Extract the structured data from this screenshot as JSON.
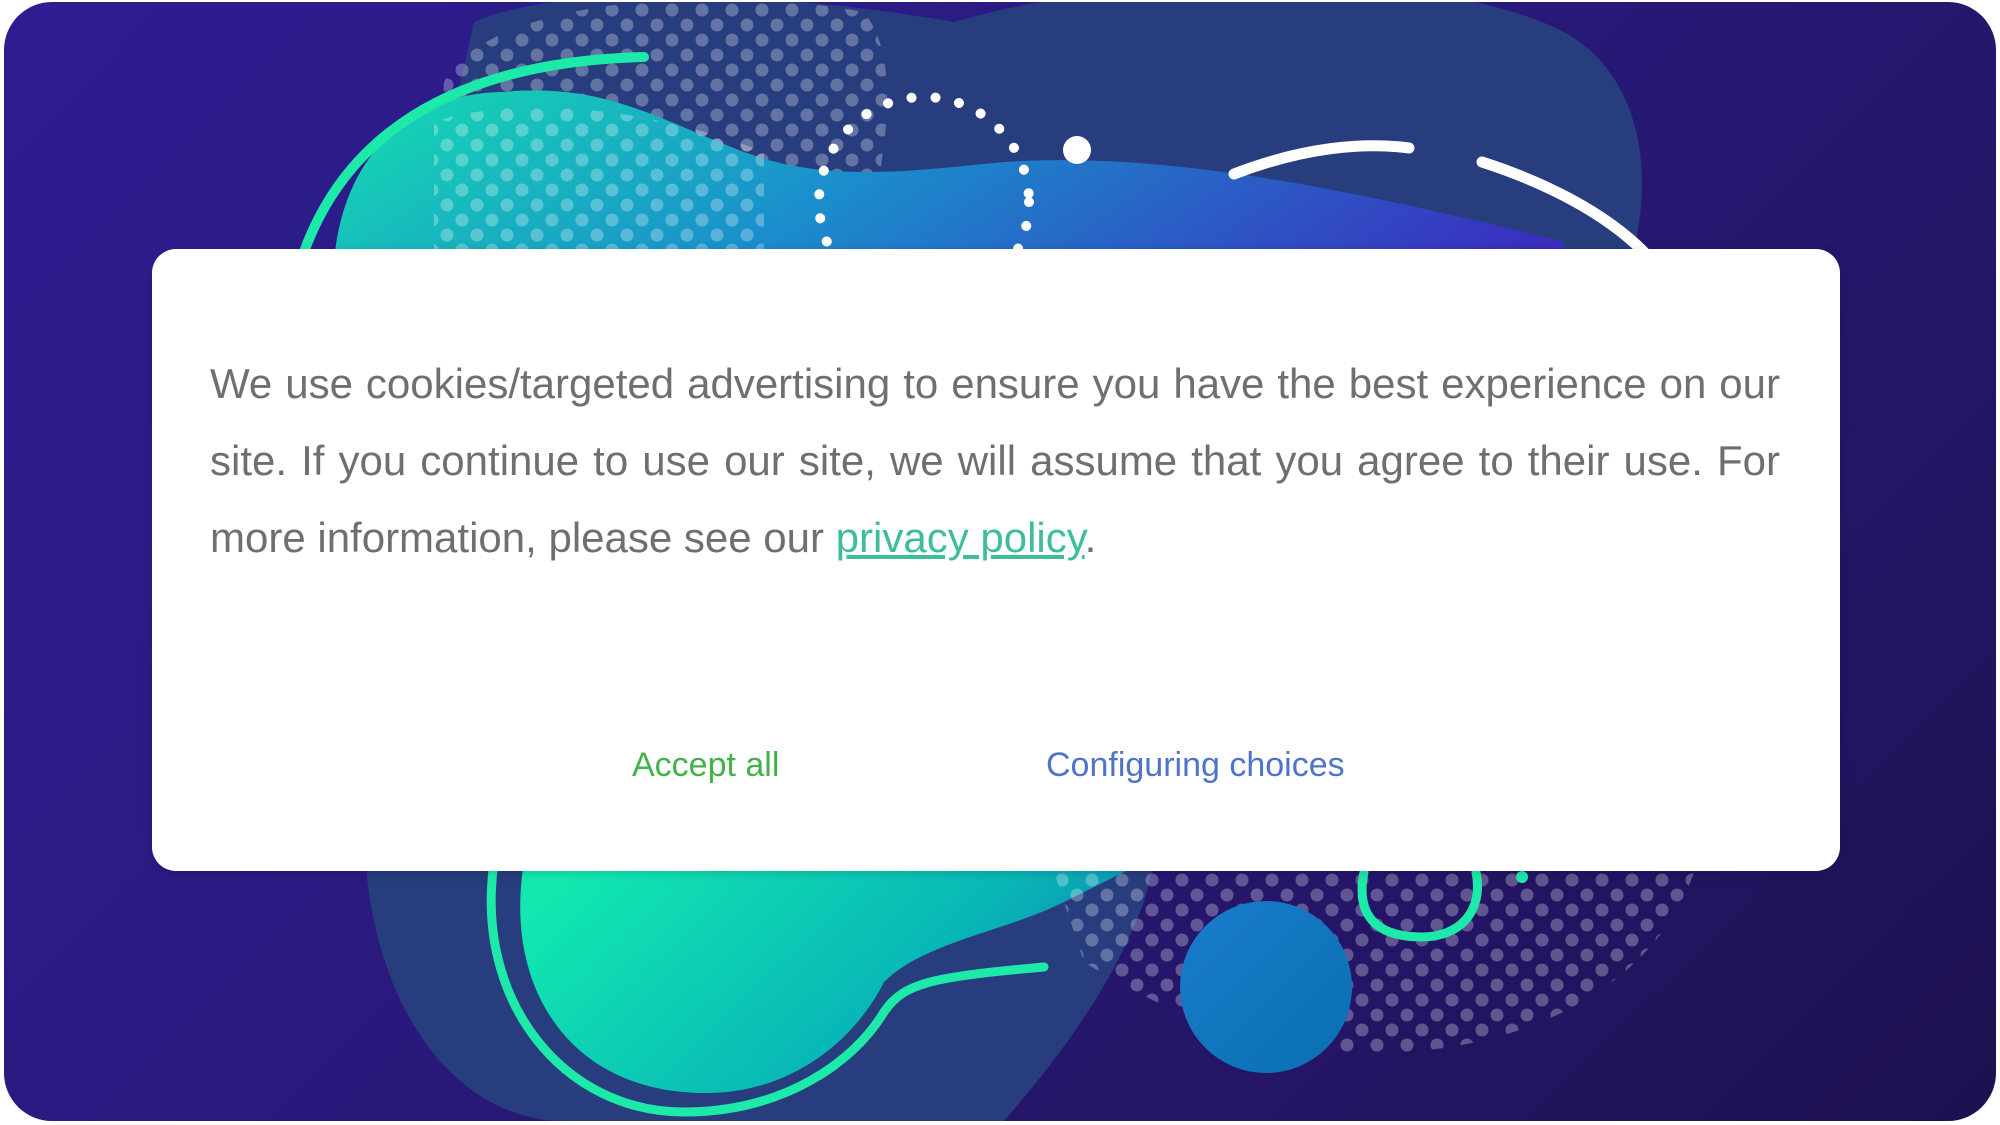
{
  "cookie_banner": {
    "message": "We use cookies/targeted advertising to ensure you have the best experience on our site. If you continue to use our site, we will assume that you agree to their use. For more information, please see our ",
    "privacy_link_label": "privacy policy",
    "message_end": ".",
    "accept_label": "Accept all",
    "configure_label": "Configuring choices"
  },
  "colors": {
    "background": "#2a1a80",
    "dialog": "#ffffff",
    "text": "#6f6f6f",
    "link": "#3dbd9d",
    "accept": "#44b24a",
    "configure": "#4f73c9",
    "accent_teal": "#1de9a8"
  },
  "icons": {
    "background": "abstract-blob-illustration"
  }
}
